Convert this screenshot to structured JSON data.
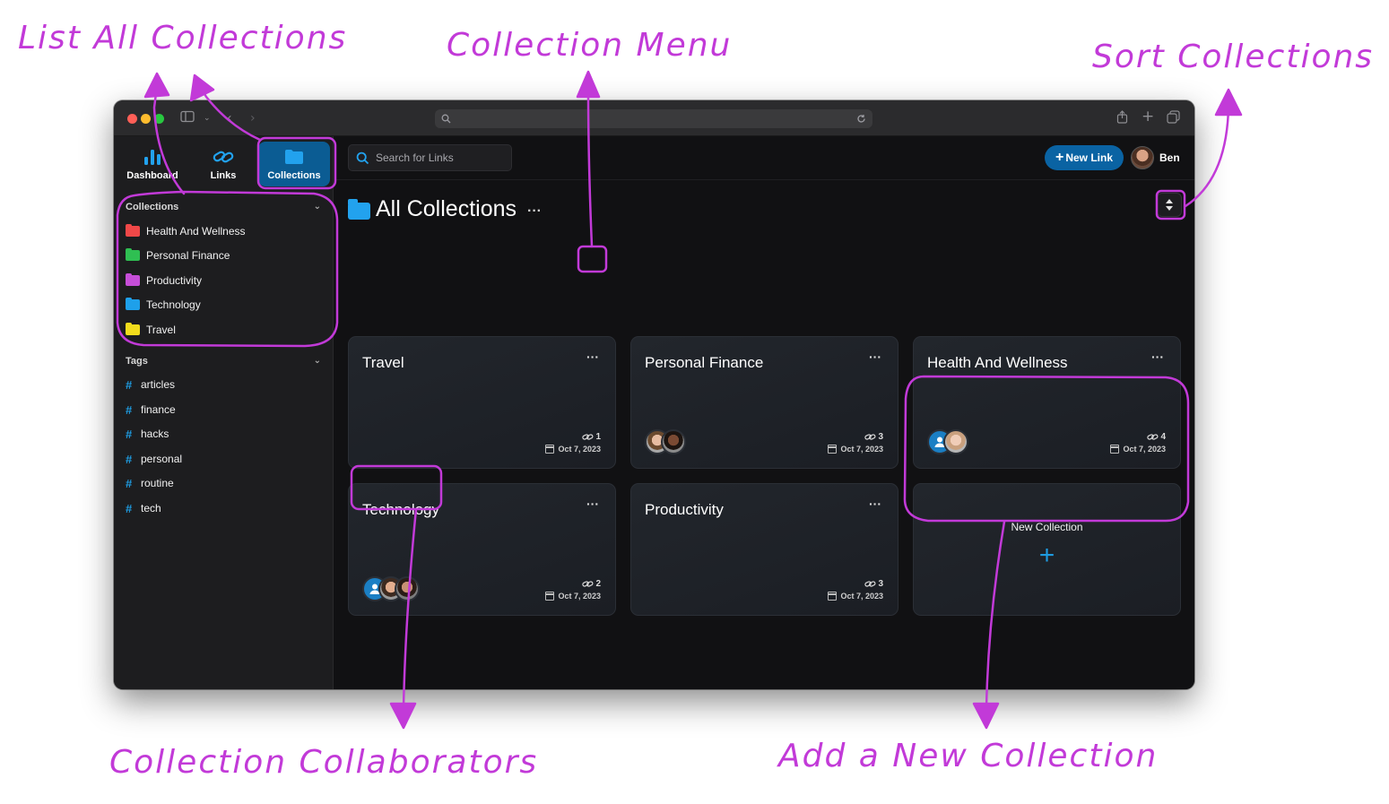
{
  "annotations": {
    "list_all": "List All Collections",
    "collection_menu": "Collection Menu",
    "sort": "Sort Collections",
    "collaborators": "Collection Collaborators",
    "add_new": "Add a New Collection"
  },
  "nav": [
    {
      "label": "Dashboard",
      "icon": "bar-chart-icon"
    },
    {
      "label": "Links",
      "icon": "link-icon"
    },
    {
      "label": "Collections",
      "icon": "folder-icon",
      "active": true
    }
  ],
  "sidebar": {
    "collections_heading": "Collections",
    "collections": [
      {
        "label": "Health And Wellness",
        "color": "#f04848"
      },
      {
        "label": "Personal Finance",
        "color": "#2fbf52"
      },
      {
        "label": "Productivity",
        "color": "#c64ed8"
      },
      {
        "label": "Technology",
        "color": "#1ea0ea"
      },
      {
        "label": "Travel",
        "color": "#f2dc1c"
      }
    ],
    "tags_heading": "Tags",
    "tags": [
      {
        "label": "articles"
      },
      {
        "label": "finance"
      },
      {
        "label": "hacks"
      },
      {
        "label": "personal"
      },
      {
        "label": "routine"
      },
      {
        "label": "tech"
      }
    ]
  },
  "header": {
    "search_placeholder": "Search for Links",
    "new_link_label": "New Link",
    "user_name": "Ben"
  },
  "page": {
    "title": "All Collections",
    "menu": "···"
  },
  "cards": [
    {
      "name": "Travel",
      "menu": "···",
      "count": "1",
      "date": "Oct 7, 2023"
    },
    {
      "name": "Personal Finance",
      "menu": "···",
      "count": "3",
      "date": "Oct 7, 2023"
    },
    {
      "name": "Health And Wellness",
      "menu": "···",
      "count": "4",
      "date": "Oct 7, 2023"
    },
    {
      "name": "Technology",
      "menu": "···",
      "count": "2",
      "date": "Oct 7, 2023"
    },
    {
      "name": "Productivity",
      "menu": "···",
      "count": "3",
      "date": "Oct 7, 2023"
    }
  ],
  "new_collection": {
    "label": "New Collection",
    "plus": "+"
  },
  "colors": {
    "accent": "#0a63a3",
    "annotation": "#c23ad8"
  }
}
